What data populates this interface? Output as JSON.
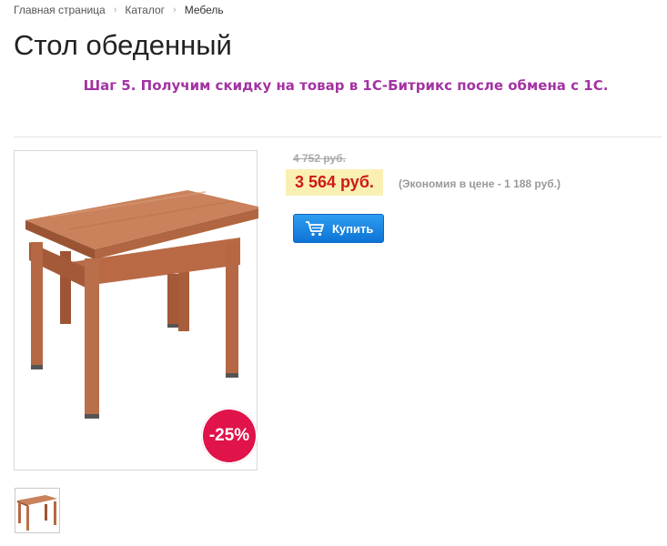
{
  "breadcrumb": {
    "items": [
      "Главная страница",
      "Каталог",
      "Мебель"
    ]
  },
  "page": {
    "title": "Стол обеденный",
    "step_note": "Шаг 5. Получим скидку на товар в 1С-Битрикс после обмена с 1С."
  },
  "product": {
    "old_price": "4 752 руб.",
    "current_price": "3 564 руб.",
    "savings": "(Экономия в цене - 1 188 руб.)",
    "discount_badge": "-25%",
    "buy_label": "Купить",
    "buy_icon": "cart-icon"
  },
  "colors": {
    "accent_title": "#a333a3",
    "price_red": "#cc1a1a",
    "price_bg": "#fbf0b4",
    "badge": "#e0134a",
    "button": "#1a83e0"
  }
}
